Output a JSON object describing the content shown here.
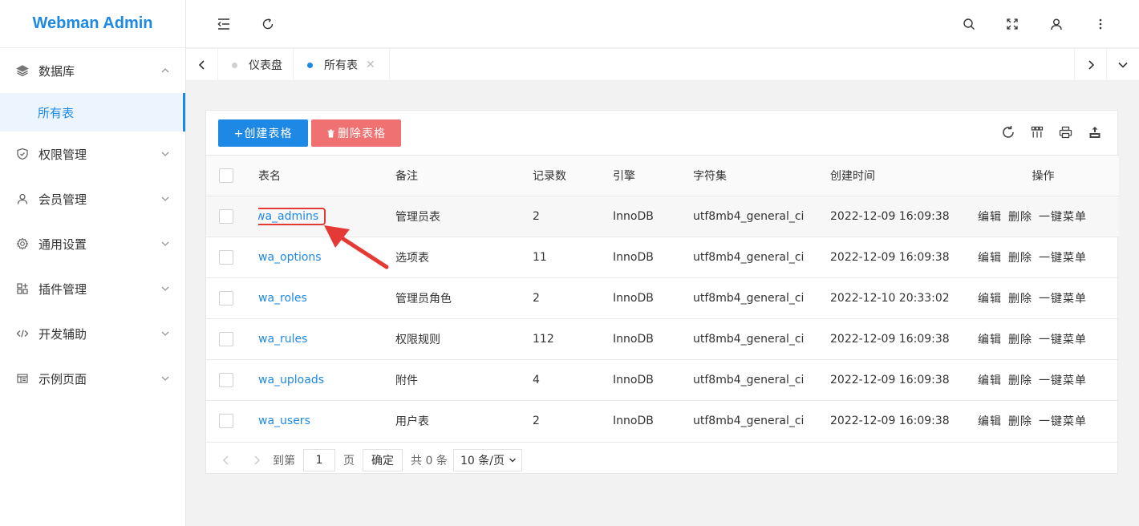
{
  "app": {
    "title": "Webman Admin"
  },
  "sidebar": {
    "items": [
      {
        "label": "数据库",
        "icon": "layers-icon",
        "expanded": true
      },
      {
        "label": "权限管理",
        "icon": "shield-icon"
      },
      {
        "label": "会员管理",
        "icon": "user-icon"
      },
      {
        "label": "通用设置",
        "icon": "gear-icon"
      },
      {
        "label": "插件管理",
        "icon": "apps-icon"
      },
      {
        "label": "开发辅助",
        "icon": "code-icon"
      },
      {
        "label": "示例页面",
        "icon": "template-icon"
      }
    ],
    "subitems": [
      {
        "label": "所有表",
        "active": true
      }
    ]
  },
  "tabs": [
    {
      "label": "仪表盘",
      "active": false
    },
    {
      "label": "所有表",
      "active": true
    }
  ],
  "toolbar": {
    "create_label": "+创建表格",
    "delete_label": "删除表格"
  },
  "table": {
    "headers": [
      "表名",
      "备注",
      "记录数",
      "引擎",
      "字符集",
      "创建时间",
      "操作"
    ],
    "rows": [
      {
        "name": "wa_admins",
        "remark": "管理员表",
        "count": "2",
        "engine": "InnoDB",
        "charset": "utf8mb4_general_ci",
        "created": "2022-12-09 16:09:38"
      },
      {
        "name": "wa_options",
        "remark": "选项表",
        "count": "11",
        "engine": "InnoDB",
        "charset": "utf8mb4_general_ci",
        "created": "2022-12-09 16:09:38"
      },
      {
        "name": "wa_roles",
        "remark": "管理员角色",
        "count": "2",
        "engine": "InnoDB",
        "charset": "utf8mb4_general_ci",
        "created": "2022-12-10 20:33:02"
      },
      {
        "name": "wa_rules",
        "remark": "权限规则",
        "count": "112",
        "engine": "InnoDB",
        "charset": "utf8mb4_general_ci",
        "created": "2022-12-09 16:09:38"
      },
      {
        "name": "wa_uploads",
        "remark": "附件",
        "count": "4",
        "engine": "InnoDB",
        "charset": "utf8mb4_general_ci",
        "created": "2022-12-09 16:09:38"
      },
      {
        "name": "wa_users",
        "remark": "用户表",
        "count": "2",
        "engine": "InnoDB",
        "charset": "utf8mb4_general_ci",
        "created": "2022-12-09 16:09:38"
      }
    ],
    "actions": {
      "edit": "编辑",
      "delete": "删除",
      "menu": "一键菜单"
    }
  },
  "pager": {
    "goto_label": "到第",
    "page_value": "1",
    "page_label": "页",
    "confirm_label": "确定",
    "total_label": "共 0 条",
    "page_size": "10 条/页"
  },
  "colors": {
    "primary": "#1e88e5",
    "danger": "#f07172",
    "annotation": "#e53935"
  }
}
